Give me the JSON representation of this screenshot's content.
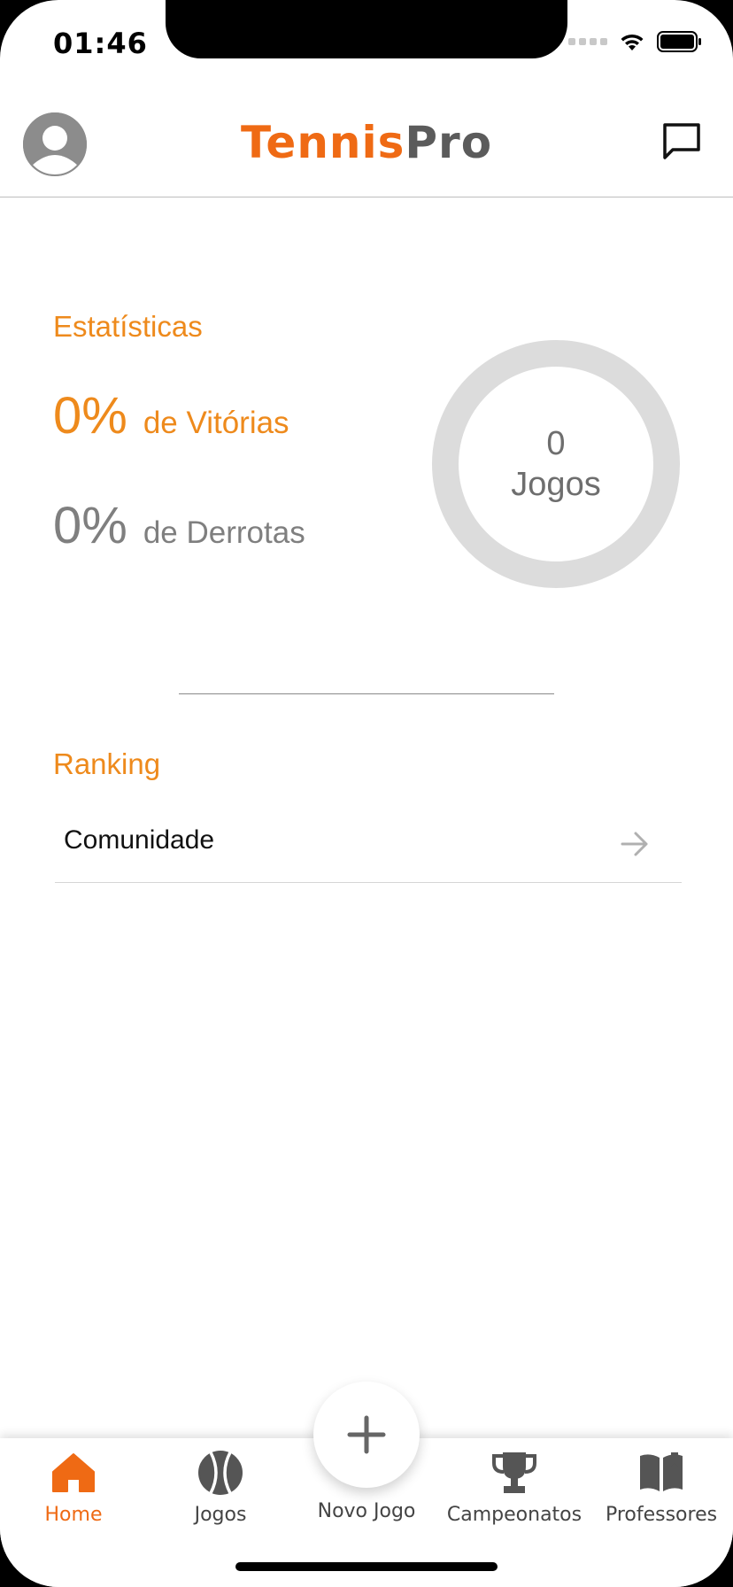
{
  "status_bar": {
    "time": "01:46"
  },
  "header": {
    "logo_part1": "Tennis",
    "logo_part2": "Pro",
    "accent_color": "#ef6a14",
    "logo_gray": "#5b5b5b"
  },
  "statistics": {
    "title": "Estatísticas",
    "wins_percent": "0%",
    "wins_label": "de Vitórias",
    "losses_percent": "0%",
    "losses_label": "de Derrotas",
    "games_count": "0",
    "games_label": "Jogos"
  },
  "ranking": {
    "title": "Ranking",
    "items": [
      {
        "label": "Comunidade"
      }
    ]
  },
  "tabbar": {
    "tabs": [
      {
        "label": "Home",
        "icon": "home-icon",
        "active": true
      },
      {
        "label": "Jogos",
        "icon": "tennis-ball-icon",
        "active": false
      },
      {
        "label": "Novo Jogo",
        "icon": "plus-icon",
        "active": false
      },
      {
        "label": "Campeonatos",
        "icon": "trophy-icon",
        "active": false
      },
      {
        "label": "Professores",
        "icon": "book-icon",
        "active": false
      }
    ]
  },
  "colors": {
    "accent": "#ef6a14",
    "orange_text": "#ee8a1c",
    "gray_text": "#7f7f7f",
    "ring": "#dcdcdc"
  }
}
